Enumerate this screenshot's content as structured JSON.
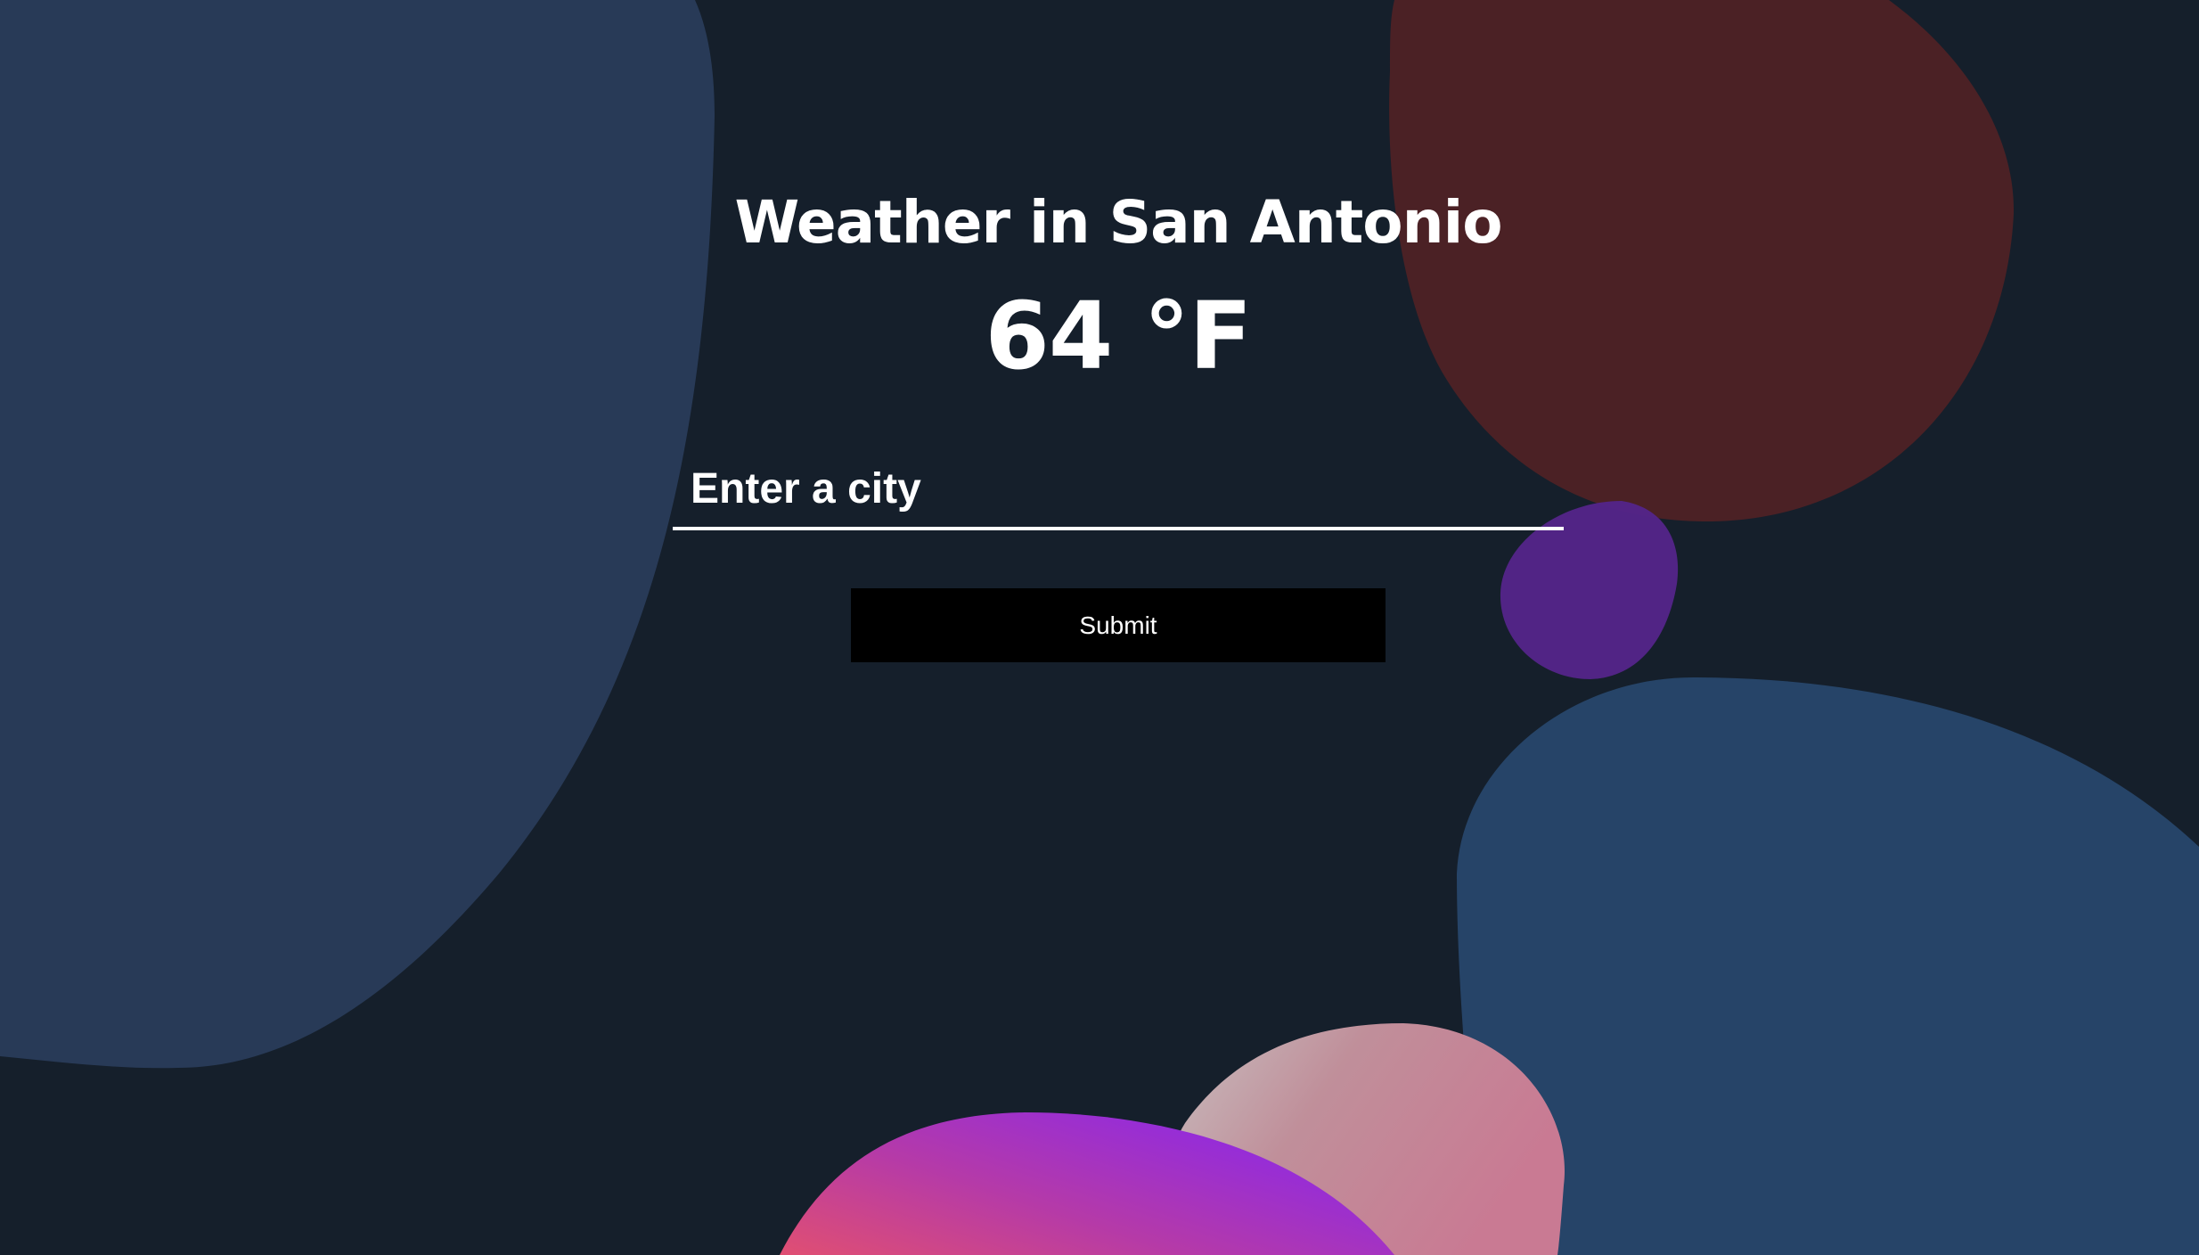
{
  "page": {
    "title": "Weather in San Antonio",
    "temperature": "64 °F"
  },
  "form": {
    "city_placeholder": "Enter a city",
    "submit_label": "Submit"
  },
  "theme": {
    "background": "#151f2b",
    "text": "#ffffff",
    "button_background": "#000000"
  }
}
